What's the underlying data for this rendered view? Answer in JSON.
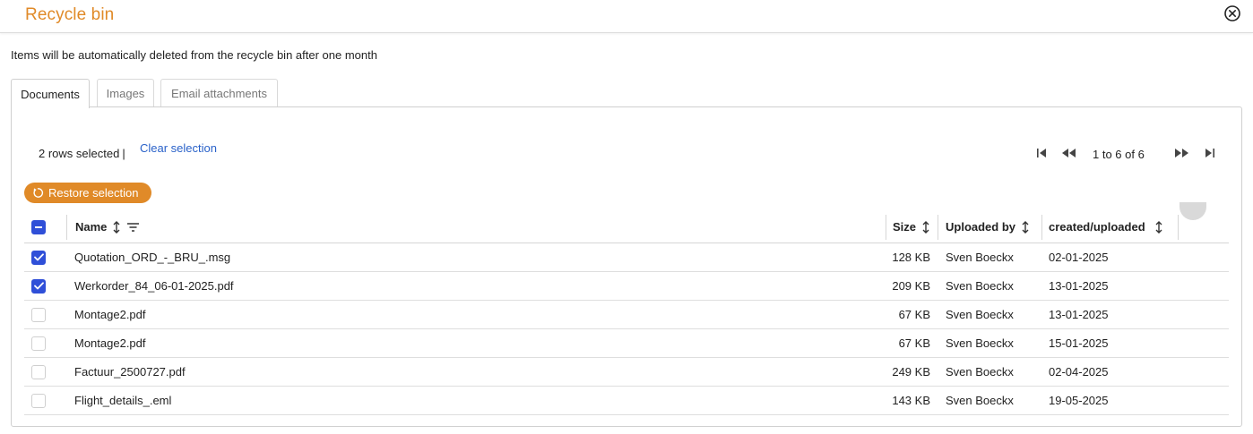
{
  "dialog": {
    "title": "Recycle bin",
    "notice": "Items will be automatically deleted from the recycle bin after one month"
  },
  "tabs": [
    {
      "label": "Documents",
      "active": true
    },
    {
      "label": "Images",
      "active": false
    },
    {
      "label": "Email attachments",
      "active": false
    }
  ],
  "selection": {
    "count_text": "2 rows selected",
    "separator": "|",
    "clear_label": "Clear selection",
    "restore_label": "Restore selection"
  },
  "pager": {
    "range_text": "1 to 6 of 6"
  },
  "table": {
    "columns": [
      "Name",
      "Size",
      "Uploaded by",
      "created/uploaded"
    ],
    "rows": [
      {
        "selected": true,
        "name": "Quotation_ORD_-_BRU_.msg",
        "size": "128 KB",
        "uploaded_by": "Sven Boeckx",
        "created": "02-01-2025"
      },
      {
        "selected": true,
        "name": "Werkorder_84_06-01-2025.pdf",
        "size": "209 KB",
        "uploaded_by": "Sven Boeckx",
        "created": "13-01-2025"
      },
      {
        "selected": false,
        "name": "Montage2.pdf",
        "size": "67 KB",
        "uploaded_by": "Sven Boeckx",
        "created": "13-01-2025"
      },
      {
        "selected": false,
        "name": "Montage2.pdf",
        "size": "67 KB",
        "uploaded_by": "Sven Boeckx",
        "created": "15-01-2025"
      },
      {
        "selected": false,
        "name": "Factuur_2500727.pdf",
        "size": "249 KB",
        "uploaded_by": "Sven Boeckx",
        "created": "02-04-2025"
      },
      {
        "selected": false,
        "name": "Flight_details_.eml",
        "size": "143 KB",
        "uploaded_by": "Sven Boeckx",
        "created": "19-05-2025"
      }
    ]
  },
  "colors": {
    "accent": "#e08a28",
    "checkbox": "#2f4fd8",
    "link": "#2a62c9"
  },
  "icons": {
    "close": "close-circle-icon",
    "restore": "restore-icon",
    "sort": "sort-icon",
    "filter": "filter-icon",
    "pager_first": "first-page-icon",
    "pager_prev": "previous-page-icon",
    "pager_next": "next-page-icon",
    "pager_last": "last-page-icon"
  }
}
